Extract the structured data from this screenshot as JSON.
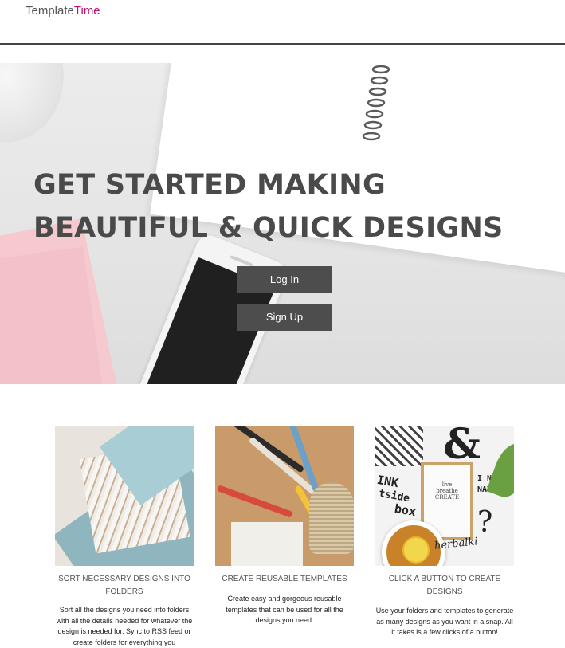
{
  "brand": {
    "part1": "Template",
    "part2": "Time",
    "accent_color": "#b5156e"
  },
  "hero": {
    "title_line1": "GET STARTED MAKING",
    "title_line2": "BEAUTIFUL & QUICK DESIGNS",
    "login_label": "Log In",
    "signup_label": "Sign Up"
  },
  "features": [
    {
      "heading": "SORT NECESSARY DESIGNS INTO FOLDERS",
      "description": "Sort all the designs you need into folders with all the details needed for whatever the design is needed for. Sync to RSS feed or create folders for everything you",
      "image_icon": "folders-photo"
    },
    {
      "heading": "CREATE REUSABLE TEMPLATES",
      "description": "Create easy and gorgeous reusable templates that can be used for all the designs you need.",
      "image_icon": "markers-photo"
    },
    {
      "heading": "CLICK A BUTTON TO CREATE DESIGNS",
      "description": "Use your folders and templates to generate as many designs as you want in a snap. All it takes is a few clicks of a button!",
      "image_icon": "prints-photo",
      "image_texts": {
        "amp": "&",
        "frame": [
          "live",
          "breathe",
          "CREATE"
        ],
        "script": "herbalki",
        "question": "?"
      }
    }
  ]
}
